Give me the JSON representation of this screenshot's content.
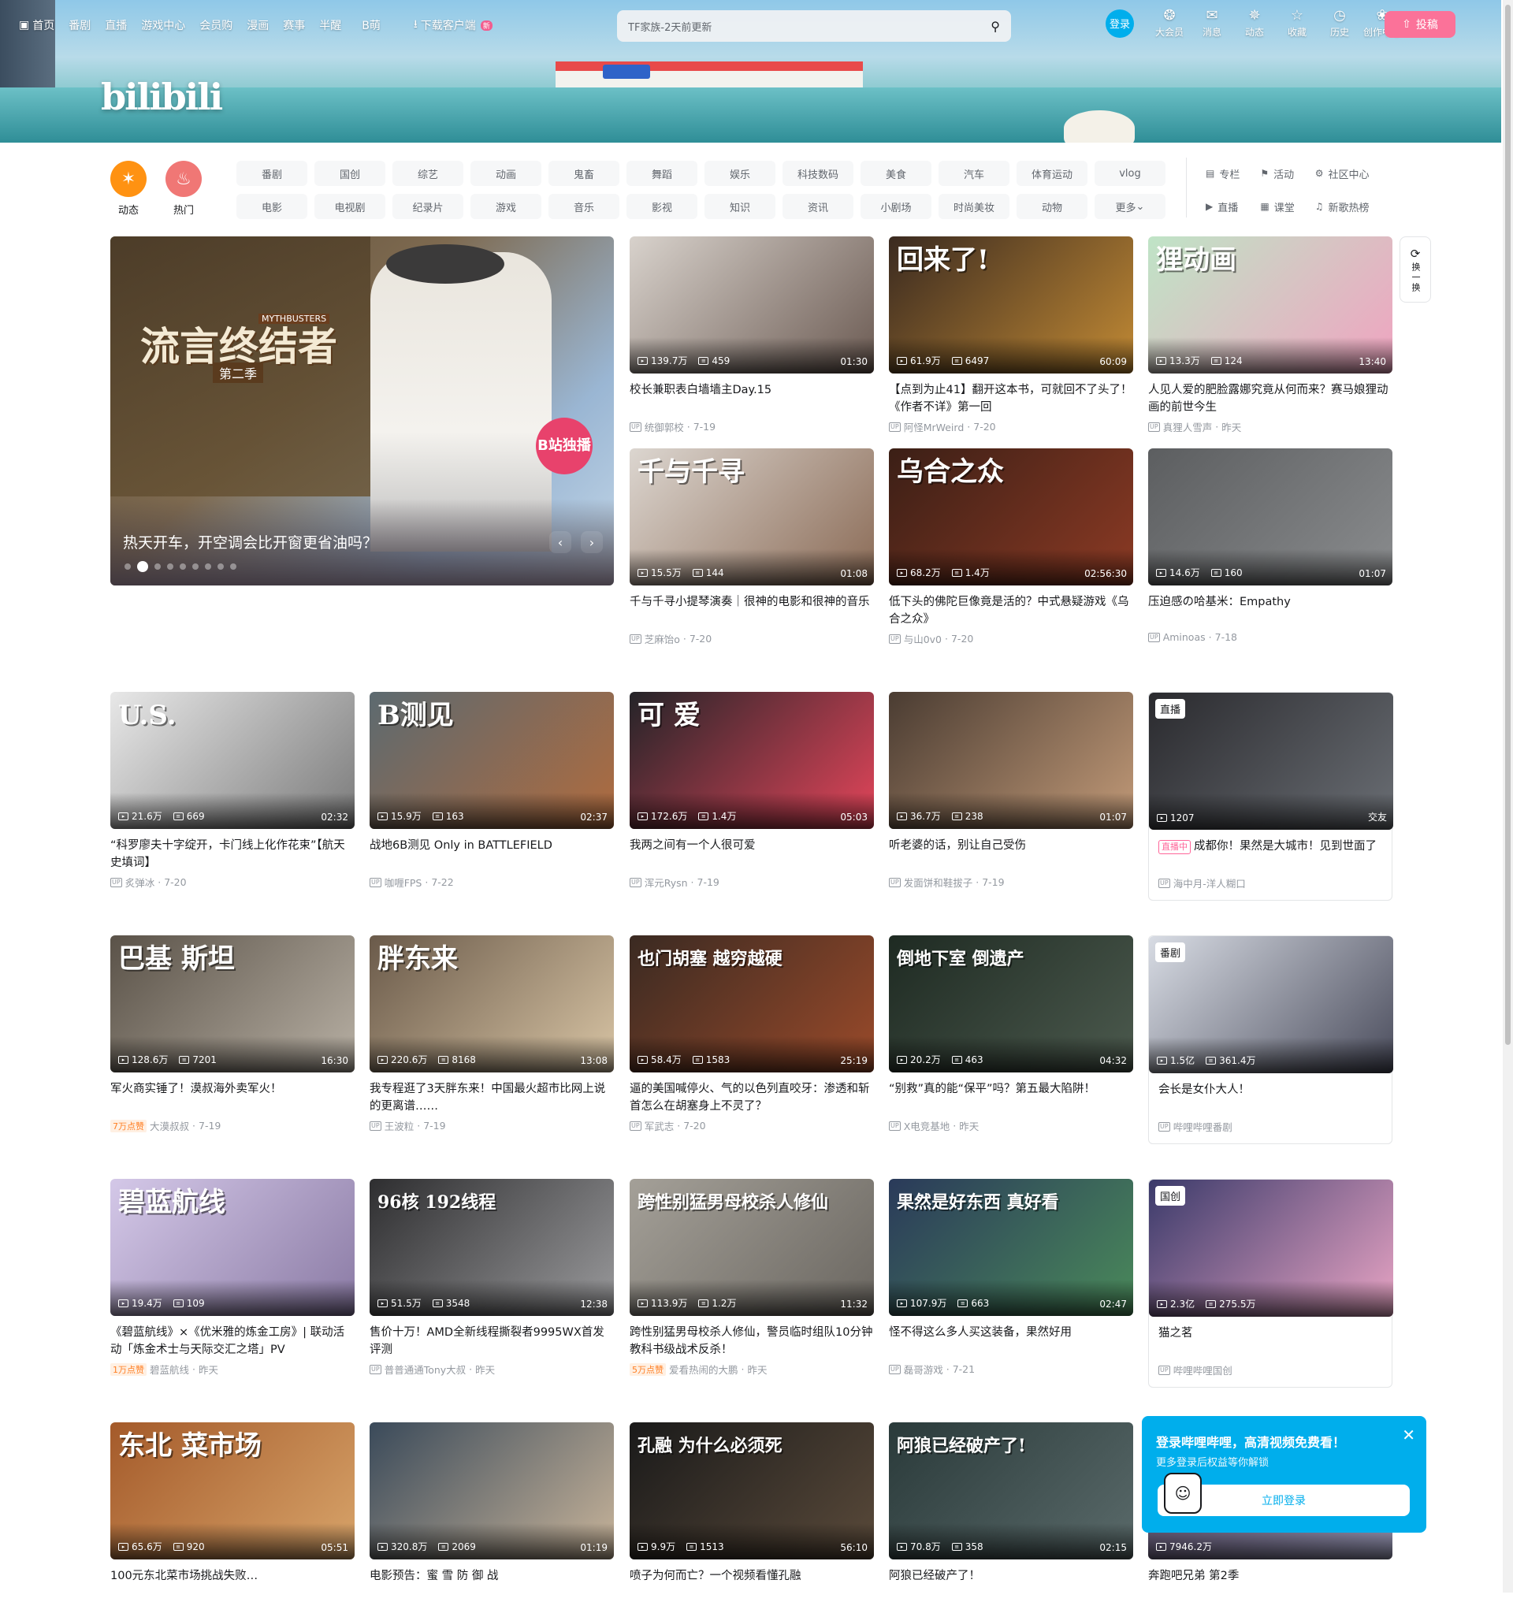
{
  "topnav": {
    "left": [
      {
        "icon": "tv-icon",
        "label": "首页"
      },
      {
        "label": "番剧"
      },
      {
        "label": "直播"
      },
      {
        "label": "游戏中心"
      },
      {
        "label": "会员购"
      },
      {
        "label": "漫画"
      },
      {
        "label": "赛事"
      },
      {
        "label": "半醒"
      },
      {
        "label": "B萌"
      },
      {
        "icon": "download-icon",
        "label": "下载客户端",
        "badge": "新"
      }
    ],
    "search_placeholder": "TF家族-2天前更新",
    "login": "登录",
    "right": [
      {
        "icon": "vip-icon",
        "label": "大会员"
      },
      {
        "icon": "message-icon",
        "label": "消息"
      },
      {
        "icon": "dynamic-icon",
        "label": "动态"
      },
      {
        "icon": "favorite-icon",
        "label": "收藏"
      },
      {
        "icon": "history-icon",
        "label": "历史"
      },
      {
        "icon": "creator-icon",
        "label": "创作中心"
      }
    ],
    "upload": "投稿"
  },
  "banner": {
    "logo": "bilibili"
  },
  "channels": {
    "big": [
      {
        "icon": "dynamic-icon",
        "label": "动态",
        "color": "#ff9212"
      },
      {
        "icon": "fire-icon",
        "label": "热门",
        "color": "#f07775"
      }
    ],
    "grid": [
      "番剧",
      "国创",
      "综艺",
      "动画",
      "鬼畜",
      "舞蹈",
      "娱乐",
      "科技数码",
      "美食",
      "汽车",
      "体育运动",
      "vlog",
      "电影",
      "电视剧",
      "纪录片",
      "游戏",
      "音乐",
      "影视",
      "知识",
      "资讯",
      "小剧场",
      "时尚美妆",
      "动物",
      "更多"
    ],
    "side": [
      {
        "icon": "column-icon",
        "label": "专栏"
      },
      {
        "icon": "activity-icon",
        "label": "活动"
      },
      {
        "icon": "community-icon",
        "label": "社区中心"
      },
      {
        "icon": "live-icon",
        "label": "直播"
      },
      {
        "icon": "classroom-icon",
        "label": "课堂"
      },
      {
        "icon": "music-icon",
        "label": "新歌热榜"
      }
    ]
  },
  "carousel": {
    "title_art": "流言终结者",
    "subtitle_art": "第二季",
    "brand": "MYTHBUSTERS",
    "stamp": "B站独播",
    "caption": "热天开车，开空调会比开窗更省油吗？",
    "active_index": 1,
    "dot_count": 9
  },
  "refresh": {
    "label": "换一换"
  },
  "cards": [
    {
      "title": "校长兼职表白墙墙主Day.15",
      "views": "139.7万",
      "danmaku": "459",
      "duration": "01:30",
      "author": "统御郭校",
      "date": "7-19",
      "art": "",
      "colors": [
        "#d8d2cc",
        "#6b5a52"
      ]
    },
    {
      "title": "【点到为止41】翻开这本书，可就回不了头了！《作者不详》第一回",
      "views": "61.9万",
      "danmaku": "6497",
      "duration": "60:09",
      "author": "阿怪MrWeird",
      "date": "7-20",
      "art": "回来了!",
      "colors": [
        "#3a2a20",
        "#c28a34"
      ]
    },
    {
      "title": "人见人爱的肥脸露娜究竟从何而来？赛马娘狸动画的前世今生",
      "views": "13.3万",
      "danmaku": "124",
      "duration": "13:40",
      "author": "真狸人雪声",
      "date": "昨天",
      "art": "狸动画",
      "colors": [
        "#bfe4c6",
        "#f0a3c0"
      ]
    },
    {
      "title": "千与千寻小提琴演奏｜很神的电影和很神的音乐",
      "views": "15.5万",
      "danmaku": "144",
      "duration": "01:08",
      "author": "芝麻饴o",
      "date": "7-20",
      "art": "千与千寻",
      "colors": [
        "#dcd6d0",
        "#8a6a55"
      ]
    },
    {
      "title": "低下头的佛陀巨像竟是活的？中式悬疑游戏《乌合之众》",
      "views": "68.2万",
      "danmaku": "1.4万",
      "duration": "02:56:30",
      "author": "与山0v0",
      "date": "7-20",
      "art": "乌合之众",
      "colors": [
        "#3b1f16",
        "#8c3a24"
      ]
    },
    {
      "title": "压迫感の哈基米：Empathy",
      "views": "14.6万",
      "danmaku": "160",
      "duration": "01:07",
      "author": "Aminoas",
      "date": "7-18",
      "art": "",
      "colors": [
        "#5c5e60",
        "#8a8c8e"
      ]
    },
    {
      "title": "“科罗廖夫十字绽开，卡门线上化作花束”【航天史填词】",
      "views": "21.6万",
      "danmaku": "669",
      "duration": "02:32",
      "author": "炙弹冰",
      "date": "7-20",
      "art": "U.S.",
      "colors": [
        "#e8e8e8",
        "#7a7a7a"
      ]
    },
    {
      "title": "战地6B测见 Only in BATTLEFIELD",
      "views": "15.9万",
      "danmaku": "163",
      "duration": "02:37",
      "author": "咖喱FPS",
      "date": "7-22",
      "art": "B测见",
      "colors": [
        "#5c6a70",
        "#b06b3e"
      ]
    },
    {
      "title": "我两之间有一个人很可爱",
      "views": "172.6万",
      "danmaku": "1.4万",
      "duration": "05:03",
      "author": "浑元Rysn",
      "date": "7-19",
      "art": "可  爱",
      "colors": [
        "#242428",
        "#e4455a"
      ]
    },
    {
      "title": "听老婆的话，别让自己受伤",
      "views": "36.7万",
      "danmaku": "238",
      "duration": "01:07",
      "author": "发面饼和鞋拔子",
      "date": "7-19",
      "art": "",
      "colors": [
        "#4a3c32",
        "#c29a78"
      ]
    },
    {
      "title": "成都你！果然是大城市！见到世面了",
      "views": "1207",
      "danmaku": "",
      "duration": "交友",
      "author": "海中月-洋人糊口",
      "date": "",
      "art": "",
      "colors": [
        "#2a2a2e",
        "#6a6e74"
      ],
      "tag": "直播",
      "live": "直播中"
    },
    {
      "title": "军火商实锤了！漠叔海外卖军火！",
      "views": "128.6万",
      "danmaku": "7201",
      "duration": "16:30",
      "author": "大漠叔叔",
      "date": "7-19",
      "art": "巴基 斯坦",
      "colors": [
        "#5a5248",
        "#b8b0a4"
      ],
      "hot": "7万点赞"
    },
    {
      "title": "我专程逛了3天胖东来！中国最火超市比网上说的更离谱……",
      "views": "220.6万",
      "danmaku": "8168",
      "duration": "13:08",
      "author": "王波粒",
      "date": "7-19",
      "art": "胖东来",
      "colors": [
        "#6a5a4a",
        "#d8c4a4"
      ]
    },
    {
      "title": "逼的美国喊停火、气的以色列直咬牙：渗透和斩首怎么在胡塞身上不灵了？",
      "views": "58.4万",
      "danmaku": "1583",
      "duration": "25:19",
      "author": "军武志",
      "date": "7-20",
      "art": "也门胡塞 越穷越硬",
      "colors": [
        "#3a2a22",
        "#9a4a2a"
      ]
    },
    {
      "title": "“别救”真的能“保平”吗？第五最大陷阱！",
      "views": "20.2万",
      "danmaku": "463",
      "duration": "04:32",
      "author": "X电竞基地",
      "date": "昨天",
      "art": "倒地下室 倒遗产",
      "colors": [
        "#1e2a22",
        "#4c5a4e"
      ]
    },
    {
      "title": "会长是女仆大人！",
      "views": "1.5亿",
      "danmaku": "361.4万",
      "duration": "",
      "author": "哔哩哔哩番剧",
      "date": "",
      "art": "",
      "colors": [
        "#d8dce4",
        "#4a4c5c"
      ],
      "tag": "番剧"
    },
    {
      "title": "《碧蓝航线》×《优米雅的炼金工房》| 联动活动「炼金术士与天际交汇之塔」PV",
      "views": "19.4万",
      "danmaku": "109",
      "duration": "",
      "author": "碧蓝航线",
      "date": "昨天",
      "art": "碧蓝航线",
      "colors": [
        "#d4c8e8",
        "#8a7aa4"
      ],
      "hot": "1万点赞"
    },
    {
      "title": "售价十万！AMD全新线程撕裂者9995WX首发评测",
      "views": "51.5万",
      "danmaku": "3548",
      "duration": "12:38",
      "author": "普普通通Tony大叔",
      "date": "昨天",
      "art": "96核 192线程",
      "colors": [
        "#2e2e30",
        "#9a9a9c"
      ]
    },
    {
      "title": "跨性别猛男母校杀人修仙，警员临时组队10分钟教科书级战术反杀！",
      "views": "113.9万",
      "danmaku": "1.2万",
      "duration": "11:32",
      "author": "爱看热闹的大鹏",
      "date": "昨天",
      "art": "跨性别猛男母校杀人修仙",
      "colors": [
        "#a4a098",
        "#6a6660"
      ],
      "hot": "5万点赞"
    },
    {
      "title": "怪不得这么多人买这装备，果然好用",
      "views": "107.9万",
      "danmaku": "663",
      "duration": "02:47",
      "author": "磊哥游戏",
      "date": "7-21",
      "art": "果然是好东西 真好看",
      "colors": [
        "#2a3a5a",
        "#4a8a5a"
      ]
    },
    {
      "title": "猫之茗",
      "views": "2.3亿",
      "danmaku": "275.5万",
      "duration": "",
      "author": "哔哩哔哩国创",
      "date": "",
      "art": "",
      "colors": [
        "#3a3a6a",
        "#e8a4c4"
      ],
      "tag": "国创"
    },
    {
      "title": "100元东北菜市场挑战失败…",
      "views": "65.6万",
      "danmaku": "920",
      "duration": "05:51",
      "author": "",
      "date": "",
      "art": "东北 菜市场",
      "colors": [
        "#a45a2a",
        "#d8a46a"
      ]
    },
    {
      "title": "电影预告：蜜 雪 防 御 战",
      "views": "320.8万",
      "danmaku": "2069",
      "duration": "01:19",
      "author": "",
      "date": "",
      "art": "",
      "colors": [
        "#3a4a5a",
        "#c8b49a"
      ]
    },
    {
      "title": "喷子为何而亡？一个视频看懂孔融",
      "views": "9.9万",
      "danmaku": "1513",
      "duration": "56:10",
      "author": "",
      "date": "",
      "art": "孔融 为什么必须死",
      "colors": [
        "#1a1a1a",
        "#5a4a3a"
      ]
    },
    {
      "title": "阿狼已经破产了！",
      "views": "70.8万",
      "danmaku": "358",
      "duration": "02:15",
      "author": "",
      "date": "",
      "art": "阿狼已经破产了!",
      "colors": [
        "#2a3a3a",
        "#5a6a6a"
      ]
    },
    {
      "title": "奔跑吧兄弟 第2季",
      "views": "7946.2万",
      "danmaku": "",
      "duration": "",
      "author": "",
      "date": "",
      "art": "",
      "colors": [
        "#5a4a6a",
        "#a4a4c4"
      ]
    }
  ],
  "login_popup": {
    "title": "登录哔哩哔哩，高清视频免费看！",
    "subtitle": "更多登录后权益等你解锁",
    "button": "立即登录"
  }
}
